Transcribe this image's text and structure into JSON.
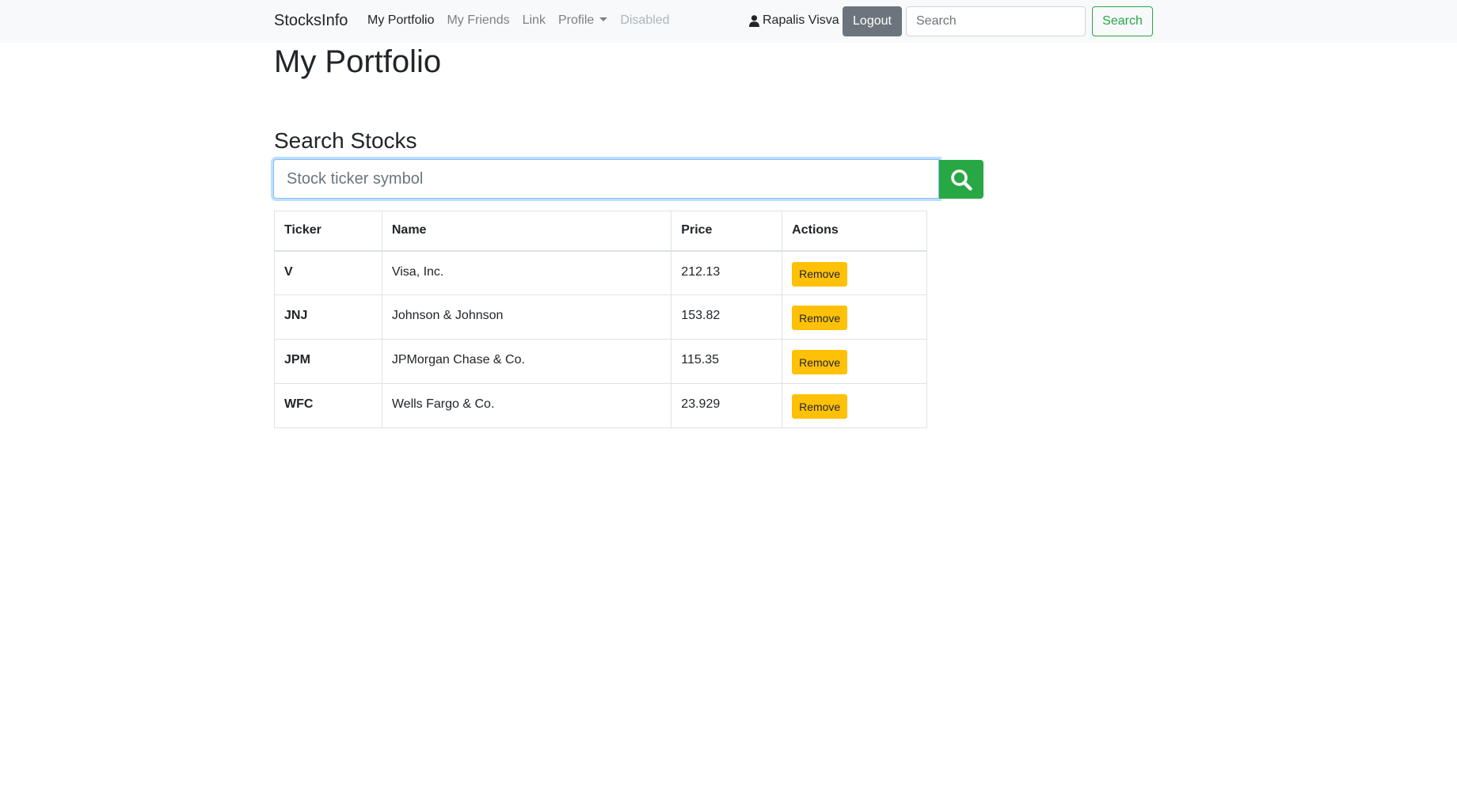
{
  "navbar": {
    "brand": "StocksInfo",
    "links": [
      {
        "label": "My Portfolio",
        "state": "active"
      },
      {
        "label": "My Friends",
        "state": "normal"
      },
      {
        "label": "Link",
        "state": "normal"
      },
      {
        "label": "Profile",
        "state": "dropdown"
      },
      {
        "label": "Disabled",
        "state": "disabled"
      }
    ],
    "user_icon": "user-icon",
    "user_name": "Rapalis Visva",
    "logout_label": "Logout",
    "search_placeholder": "Search",
    "search_button_label": "Search"
  },
  "main": {
    "title": "My Portfolio",
    "search_section_title": "Search Stocks",
    "ticker_input_placeholder": "Stock ticker symbol",
    "ticker_search_icon": "search-icon"
  },
  "table": {
    "headers": {
      "ticker": "Ticker",
      "name": "Name",
      "price": "Price",
      "actions": "Actions"
    },
    "rows": [
      {
        "ticker": "V",
        "name": "Visa, Inc.",
        "price": "212.13",
        "action": "Remove"
      },
      {
        "ticker": "JNJ",
        "name": "Johnson & Johnson",
        "price": "153.82",
        "action": "Remove"
      },
      {
        "ticker": "JPM",
        "name": "JPMorgan Chase & Co.",
        "price": "115.35",
        "action": "Remove"
      },
      {
        "ticker": "WFC",
        "name": "Wells Fargo & Co.",
        "price": "23.929",
        "action": "Remove"
      }
    ]
  },
  "colors": {
    "navbar_bg": "#f8f9fa",
    "success": "#28a745",
    "secondary": "#6c757d",
    "warning": "#ffc107"
  }
}
